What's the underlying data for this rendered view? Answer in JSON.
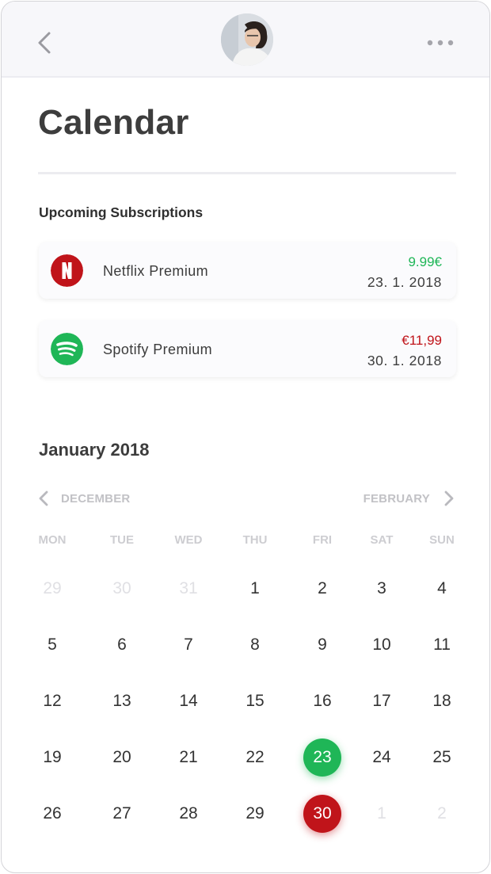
{
  "header": {
    "back_icon": "chevron-left-icon",
    "avatar": "user-avatar-photo",
    "more_icon": "more-horizontal-icon"
  },
  "page_title": "Calendar",
  "upcoming": {
    "label": "Upcoming Subscriptions",
    "items": [
      {
        "name": "Netflix Premium",
        "price": "9.99€",
        "date": "23. 1. 2018",
        "icon": "netflix-icon",
        "price_color": "#1fb657",
        "logo_color": "#c0141a"
      },
      {
        "name": "Spotify Premium",
        "price": "€11,99",
        "date": "30. 1. 2018",
        "icon": "spotify-icon",
        "price_color": "#c0141a",
        "logo_color": "#1fb657"
      }
    ]
  },
  "calendar": {
    "month_title": "January 2018",
    "prev_label": "DECEMBER",
    "next_label": "FEBRUARY",
    "weekdays": [
      "MON",
      "TUE",
      "WED",
      "THU",
      "FRI",
      "SAT",
      "SUN"
    ],
    "weeks": [
      [
        {
          "d": "29",
          "muted": true
        },
        {
          "d": "30",
          "muted": true
        },
        {
          "d": "31",
          "muted": true
        },
        {
          "d": "1"
        },
        {
          "d": "2"
        },
        {
          "d": "3"
        },
        {
          "d": "4"
        }
      ],
      [
        {
          "d": "5"
        },
        {
          "d": "6"
        },
        {
          "d": "7"
        },
        {
          "d": "8"
        },
        {
          "d": "9"
        },
        {
          "d": "10"
        },
        {
          "d": "11"
        }
      ],
      [
        {
          "d": "12"
        },
        {
          "d": "13"
        },
        {
          "d": "14"
        },
        {
          "d": "15"
        },
        {
          "d": "16"
        },
        {
          "d": "17"
        },
        {
          "d": "18"
        }
      ],
      [
        {
          "d": "19"
        },
        {
          "d": "20"
        },
        {
          "d": "21"
        },
        {
          "d": "22"
        },
        {
          "d": "23",
          "mark": "green"
        },
        {
          "d": "24"
        },
        {
          "d": "25"
        }
      ],
      [
        {
          "d": "26"
        },
        {
          "d": "27"
        },
        {
          "d": "28"
        },
        {
          "d": "29"
        },
        {
          "d": "30",
          "mark": "red"
        },
        {
          "d": "1",
          "muted": true
        },
        {
          "d": "2",
          "muted": true
        }
      ]
    ]
  }
}
